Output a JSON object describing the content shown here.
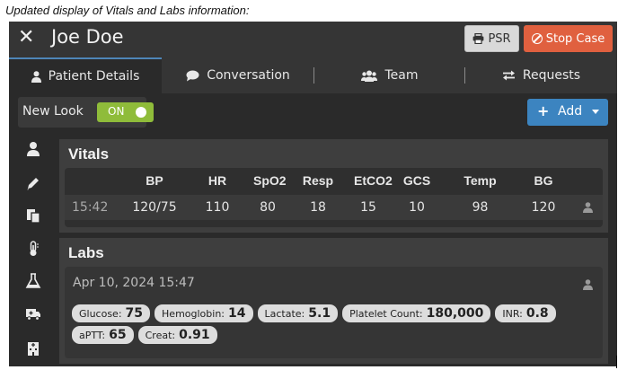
{
  "caption": "Updated display of Vitals and Labs information:",
  "header": {
    "patient_name": "Joe Doe",
    "psr_label": "PSR",
    "stop_label": "Stop Case"
  },
  "tabs": [
    {
      "label": "Patient Details",
      "icon": "user-icon",
      "active": true
    },
    {
      "label": "Conversation",
      "icon": "chat-icon",
      "active": false
    },
    {
      "label": "Team",
      "icon": "team-icon",
      "active": false
    },
    {
      "label": "Requests",
      "icon": "exchange-icon",
      "active": false
    }
  ],
  "new_look": {
    "label": "New Look",
    "state": "ON"
  },
  "add_button": {
    "label": "Add"
  },
  "sidebar_icons": [
    "user-icon",
    "pencil-icon",
    "clipboard-icon",
    "thermometer-icon",
    "flask-icon",
    "ambulance-icon",
    "hospital-icon"
  ],
  "vitals": {
    "title": "Vitals",
    "headers": [
      "BP",
      "HR",
      "SpO2",
      "Resp",
      "EtCO2",
      "GCS",
      "Temp",
      "BG"
    ],
    "row": {
      "time": "15:42",
      "values": [
        "120/75",
        "110",
        "80",
        "18",
        "15",
        "10",
        "98",
        "120"
      ]
    }
  },
  "labs": {
    "title": "Labs",
    "date": "Apr 10, 2024 15:47",
    "results": [
      {
        "name": "Glucose:",
        "value": "75"
      },
      {
        "name": "Hemoglobin:",
        "value": "14"
      },
      {
        "name": "Lactate:",
        "value": "5.1"
      },
      {
        "name": "Platelet Count:",
        "value": "180,000"
      },
      {
        "name": "INR:",
        "value": "0.8"
      },
      {
        "name": "aPTT:",
        "value": "65"
      },
      {
        "name": "Creat:",
        "value": "0.91"
      }
    ]
  },
  "colors": {
    "accent_blue": "#3c84c0",
    "stop_red": "#e0603f",
    "toggle_green": "#8fbc3a"
  }
}
